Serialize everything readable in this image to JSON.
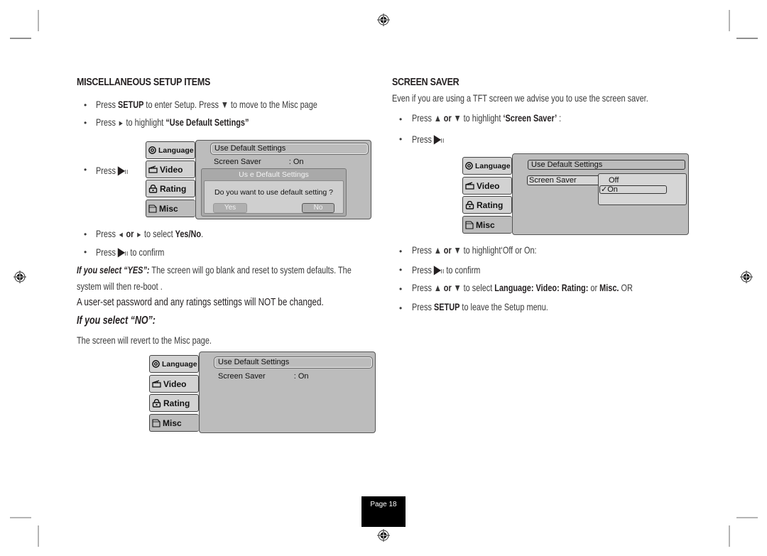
{
  "page": {
    "number_label": "Page 18"
  },
  "left": {
    "heading": "MISCELLANEOUS SETUP ITEMS",
    "steps1": [
      {
        "pre": "Press ",
        "bold": "SETUP",
        "mid": " to enter Setup. Press ",
        "icon": "down-triangle",
        "post": "  to move to the Misc page"
      },
      {
        "pre": "Press ",
        "icon": "right-triangle",
        "mid": " to highlight ",
        "bold": "“Use Default Settings”"
      }
    ],
    "press_play_label": "Press",
    "steps2": [
      {
        "pre": "Press ",
        "bold_mid": "or",
        "post": " to select ",
        "bold": "Yes/No",
        "end": "."
      },
      {
        "pre": "Press ",
        "post": " to confirm"
      }
    ],
    "yes_heading": "If you select “YES”:",
    "yes_text_1": "  The screen will go blank and reset to system defaults. The",
    "yes_text_2": "system will then re-boot .",
    "warning": "A user-set password and any ratings settings will NOT be changed.",
    "no_heading": "If you select “NO”:",
    "no_text": "The screen will revert to the Misc page."
  },
  "right": {
    "heading": "SCREEN SAVER",
    "intro": "Even if you are using a TFT screen we advise you to use the screen saver.",
    "steps1": [
      {
        "pre": "Press ",
        "or": " or ",
        "post": "  to highlight ",
        "bold": "‘Screen Saver’",
        "end": " :"
      },
      {
        "pre": "Press "
      }
    ],
    "steps2": [
      {
        "pre": "Press ",
        "or": " or ",
        "post": "  to highlight‘Off or On:"
      },
      {
        "pre": "Press ",
        "post": " to confirm"
      },
      {
        "pre": "Press ",
        "or": " or ",
        "post": "  to select ",
        "bold": "Language: Video: Rating:",
        "mid": " or ",
        "bold2": "Misc.",
        "end": "  OR"
      },
      {
        "pre": "Press ",
        "bold": "SETUP",
        "post": " to leave the Setup menu."
      }
    ]
  },
  "osd": {
    "tabs": [
      "Language",
      "Video",
      "Rating",
      "Misc"
    ],
    "use_default": "Use Default Settings",
    "screen_saver": "Screen Saver",
    "screen_saver_value": ": On",
    "dialog": {
      "title": "Us e Default  Settings",
      "question": "Do you want to use default setting ?",
      "yes": "Yes",
      "no": "No"
    },
    "dropdown_options": [
      "Off",
      "On"
    ],
    "dropdown_selected": "On"
  }
}
